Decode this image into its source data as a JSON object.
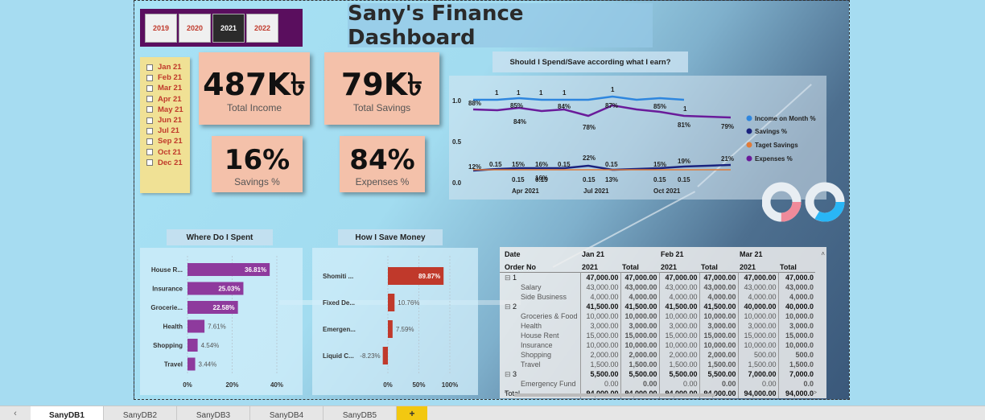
{
  "title": "Sany's Finance Dashboard",
  "years": [
    {
      "label": "2019",
      "active": false
    },
    {
      "label": "2020",
      "active": false
    },
    {
      "label": "2021",
      "active": true
    },
    {
      "label": "2022",
      "active": false
    }
  ],
  "months": [
    "Jan 21",
    "Feb 21",
    "Mar 21",
    "Apr 21",
    "May 21",
    "Jun 21",
    "Jul 21",
    "Sep 21",
    "Oct 21",
    "Dec 21"
  ],
  "kpis": {
    "total_income": {
      "value": "487K৳",
      "label": "Total Income"
    },
    "total_savings": {
      "value": "79K৳",
      "label": "Total Savings"
    },
    "savings_pct": {
      "value": "16%",
      "label": "Savings %"
    },
    "expenses_pct": {
      "value": "84%",
      "label": "Expenses %"
    }
  },
  "line_chart": {
    "title": "Should I Spend/Save according what I earn?",
    "y_ticks": [
      "1.0",
      "0.5",
      "0.0"
    ],
    "x_ticks": [
      "Apr 2021",
      "Jul 2021",
      "Oct 2021"
    ],
    "legend": [
      {
        "name": "Income on Month %",
        "color": "#2e86de"
      },
      {
        "name": "Savings %",
        "color": "#1a237e"
      },
      {
        "name": "Taget Savings",
        "color": "#e07b39"
      },
      {
        "name": "Expenses %",
        "color": "#6a1b9a"
      }
    ],
    "income_labels": [
      "1",
      "1",
      "1",
      "1",
      "1",
      "1"
    ],
    "expense_labels": [
      "88%",
      "85%",
      "84%",
      "84%",
      "78%",
      "87%",
      "85%",
      "81%",
      "79%"
    ],
    "savings_labels": [
      "12%",
      "15%",
      "16%",
      "16%",
      "22%",
      "13%",
      "15%",
      "19%",
      "21%"
    ],
    "target_labels": [
      "0.15",
      "0.15",
      "0.15",
      "0.15",
      "0.15",
      "0.15",
      "0.15",
      "0.15",
      "0.15",
      "0.15"
    ]
  },
  "spent_chart": {
    "title": "Where Do I Spent",
    "color": "#8e3a9d",
    "categories": [
      "House R...",
      "Insurance",
      "Grocerie...",
      "Health",
      "Shopping",
      "Travel"
    ],
    "value_labels": [
      "36.81%",
      "25.03%",
      "22.58%",
      "7.61%",
      "4.54%",
      "3.44%"
    ],
    "values": [
      36.81,
      25.03,
      22.58,
      7.61,
      4.54,
      3.44
    ],
    "x_ticks": [
      "0%",
      "20%",
      "40%"
    ]
  },
  "save_chart": {
    "title": "How I Save Money",
    "color": "#c0392b",
    "categories": [
      "Shomiti ...",
      "Fixed De...",
      "Emergen...",
      "Liquid C..."
    ],
    "value_labels": [
      "89.87%",
      "10.76%",
      "7.59%",
      "-8.23%"
    ],
    "values": [
      89.87,
      10.76,
      7.59,
      -8.23
    ],
    "x_ticks": [
      "0%",
      "50%",
      "100%"
    ]
  },
  "matrix": {
    "header1": [
      "Date",
      "Jan 21",
      "",
      "Feb 21",
      "",
      "Mar 21",
      ""
    ],
    "header2": [
      "Order No",
      "2021",
      "Total",
      "2021",
      "Total",
      "2021",
      "Total"
    ],
    "rows": [
      {
        "level": 0,
        "cells": [
          "1",
          "47,000.00",
          "47,000.00",
          "47,000.00",
          "47,000.00",
          "47,000.00",
          "47,000.0"
        ]
      },
      {
        "level": 1,
        "cells": [
          "Salary",
          "43,000.00",
          "43,000.00",
          "43,000.00",
          "43,000.00",
          "43,000.00",
          "43,000.0"
        ]
      },
      {
        "level": 1,
        "cells": [
          "Side Business",
          "4,000.00",
          "4,000.00",
          "4,000.00",
          "4,000.00",
          "4,000.00",
          "4,000.0"
        ]
      },
      {
        "level": 0,
        "cells": [
          "2",
          "41,500.00",
          "41,500.00",
          "41,500.00",
          "41,500.00",
          "40,000.00",
          "40,000.0"
        ]
      },
      {
        "level": 1,
        "cells": [
          "Groceries & Food",
          "10,000.00",
          "10,000.00",
          "10,000.00",
          "10,000.00",
          "10,000.00",
          "10,000.0"
        ]
      },
      {
        "level": 1,
        "cells": [
          "Health",
          "3,000.00",
          "3,000.00",
          "3,000.00",
          "3,000.00",
          "3,000.00",
          "3,000.0"
        ]
      },
      {
        "level": 1,
        "cells": [
          "House Rent",
          "15,000.00",
          "15,000.00",
          "15,000.00",
          "15,000.00",
          "15,000.00",
          "15,000.0"
        ]
      },
      {
        "level": 1,
        "cells": [
          "Insurance",
          "10,000.00",
          "10,000.00",
          "10,000.00",
          "10,000.00",
          "10,000.00",
          "10,000.0"
        ]
      },
      {
        "level": 1,
        "cells": [
          "Shopping",
          "2,000.00",
          "2,000.00",
          "2,000.00",
          "2,000.00",
          "500.00",
          "500.0"
        ]
      },
      {
        "level": 1,
        "cells": [
          "Travel",
          "1,500.00",
          "1,500.00",
          "1,500.00",
          "1,500.00",
          "1,500.00",
          "1,500.0"
        ]
      },
      {
        "level": 0,
        "cells": [
          "3",
          "5,500.00",
          "5,500.00",
          "5,500.00",
          "5,500.00",
          "7,000.00",
          "7,000.0"
        ]
      },
      {
        "level": 1,
        "cells": [
          "Emergency Fund",
          "0.00",
          "0.00",
          "0.00",
          "0.00",
          "0.00",
          "0.0"
        ]
      },
      {
        "level": 2,
        "cells": [
          "Total",
          "94,000.00",
          "94,000.00",
          "94,000.00",
          "94,000.00",
          "94,000.00",
          "94,000.0"
        ]
      }
    ]
  },
  "tabs": [
    {
      "label": "SanyDB1",
      "active": true
    },
    {
      "label": "SanyDB2",
      "active": false
    },
    {
      "label": "SanyDB3",
      "active": false
    },
    {
      "label": "SanyDB4",
      "active": false
    },
    {
      "label": "SanyDB5",
      "active": false
    }
  ],
  "add_tab": "+"
}
